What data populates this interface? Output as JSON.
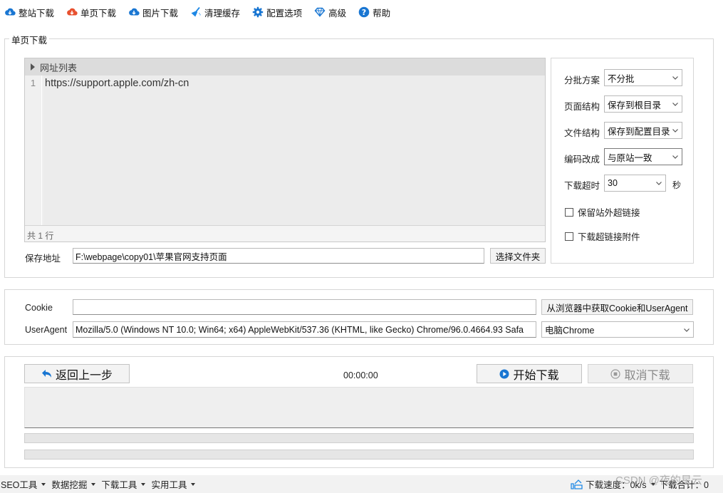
{
  "toolbar": {
    "items": [
      {
        "label": "整站下载",
        "icon": "cloud-download-icon",
        "color": "#1976d2"
      },
      {
        "label": "单页下载",
        "icon": "cloud-download-icon",
        "color": "#e8502e"
      },
      {
        "label": "图片下载",
        "icon": "cloud-download-icon",
        "color": "#1976d2"
      },
      {
        "label": "清理缓存",
        "icon": "broom-icon",
        "color": "#1e88e5"
      },
      {
        "label": "配置选项",
        "icon": "gear-icon",
        "color": "#1976d2"
      },
      {
        "label": "高级",
        "icon": "diamond-icon",
        "color": "#1976d2"
      },
      {
        "label": "帮助",
        "icon": "help-icon",
        "color": "#1976d2"
      }
    ]
  },
  "single_page": {
    "legend": "单页下载",
    "editor": {
      "header": "网址列表",
      "line_number": "1",
      "url_line": "https://support.apple.com/zh-cn",
      "footer": "共 1 行"
    },
    "save_label": "保存地址",
    "save_path": "F:\\webpage\\copy01\\苹果官网支持页面",
    "choose_folder": "选择文件夹",
    "options": {
      "batch_label": "分批方案",
      "batch_value": "不分批",
      "page_structure_label": "页面结构",
      "page_structure_value": "保存到根目录",
      "file_structure_label": "文件结构",
      "file_structure_value": "保存到配置目录",
      "encoding_label": "编码改成",
      "encoding_value": "与原站一致",
      "timeout_label": "下载超时",
      "timeout_value": "30",
      "timeout_unit": "秒",
      "keep_external_label": "保留站外超链接",
      "download_attachments_label": "下载超链接附件"
    }
  },
  "request": {
    "cookie_label": "Cookie",
    "cookie_value": "",
    "get_cookie_button": "从浏览器中获取Cookie和UserAgent",
    "ua_label": "UserAgent",
    "ua_value": "Mozilla/5.0 (Windows NT 10.0; Win64; x64) AppleWebKit/537.36 (KHTML, like Gecko) Chrome/96.0.4664.93 Safa",
    "ua_preset": "电脑Chrome"
  },
  "control": {
    "back_button": "返回上一步",
    "timer": "00:00:00",
    "start_button": "开始下载",
    "cancel_button": "取消下载",
    "progress_1": 0,
    "progress_2": 0
  },
  "statusbar": {
    "menus": [
      "SEO工具",
      "数据挖掘",
      "下载工具",
      "实用工具"
    ],
    "speed": "下载速度：0k/s",
    "total": "下载合计：0",
    "watermark": "CSDN @夜的星云"
  }
}
